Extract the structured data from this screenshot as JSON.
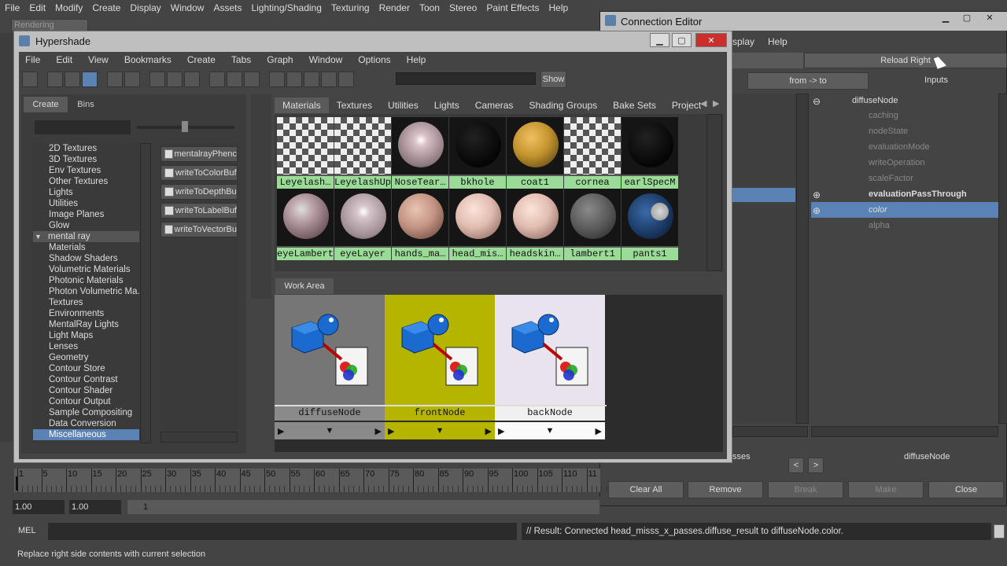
{
  "main_menu": [
    "File",
    "Edit",
    "Modify",
    "Create",
    "Display",
    "Window",
    "Assets",
    "Lighting/Shading",
    "Texturing",
    "Render",
    "Toon",
    "Stereo",
    "Paint Effects",
    "Help"
  ],
  "renderer_select": "Rendering",
  "connection_editor": {
    "title": "Connection Editor",
    "menu_partial": [
      "splay",
      "Help"
    ],
    "reload_right": "Reload Right",
    "from_to": "from -> to",
    "inputs": "Inputs",
    "right_node": "diffuseNode",
    "attributes": [
      "caching",
      "nodeState",
      "evaluationMode",
      "writeOperation",
      "scaleFactor",
      "evaluationPassThrough",
      "color",
      "alpha"
    ],
    "left_label_partial": "sses",
    "bottom_node": "diffuseNode",
    "buttons": [
      "Clear All",
      "Remove",
      "Break",
      "Make",
      "Close"
    ]
  },
  "hypershade": {
    "title": "Hypershade",
    "menu": [
      "File",
      "Edit",
      "View",
      "Bookmarks",
      "Create",
      "Tabs",
      "Graph",
      "Window",
      "Options",
      "Help"
    ],
    "show_button": "Show",
    "create_tabs": [
      "Create",
      "Bins"
    ],
    "create_list": [
      "2D Textures",
      "3D Textures",
      "Env Textures",
      "Other Textures",
      "Lights",
      "Utilities",
      "Image Planes",
      "Glow",
      "mental ray",
      "Materials",
      "Shadow Shaders",
      "Volumetric Materials",
      "Photonic Materials",
      "Photon Volumetric Ma...",
      "Textures",
      "Environments",
      "MentalRay Lights",
      "Light Maps",
      "Lenses",
      "Geometry",
      "Contour Store",
      "Contour Contrast",
      "Contour Shader",
      "Contour Output",
      "Sample Compositing",
      "Data Conversion",
      "Miscellaneous"
    ],
    "node_types": [
      "mentalrayPhenc",
      "writeToColorBuf",
      "writeToDepthBu",
      "writeToLabelBuf",
      "writeToVectorBu"
    ],
    "tabs": [
      "Materials",
      "Textures",
      "Utilities",
      "Lights",
      "Cameras",
      "Shading Groups",
      "Bake Sets",
      "Project"
    ],
    "swatches_row1": [
      "Leyelash…",
      "LeyelashUp",
      "NoseTear…",
      "bkhole",
      "coat1",
      "cornea",
      "earlSpecM"
    ],
    "swatches_row2": [
      "eyeLambert",
      "eyeLayer",
      "hands_ma…",
      "head_mis…",
      "headskin…",
      "lambert1",
      "pants1"
    ],
    "work_area_tab": "Work Area",
    "nodes": [
      {
        "name": "diffuseNode",
        "color": "#767676"
      },
      {
        "name": "frontNode",
        "color": "#b5b500"
      },
      {
        "name": "backNode",
        "color": "#e8e3ec"
      }
    ]
  },
  "timeline": {
    "ticks": [
      "1",
      "5",
      "10",
      "15",
      "20",
      "25",
      "30",
      "35",
      "40",
      "45",
      "50",
      "55",
      "60",
      "65",
      "70",
      "75",
      "80",
      "85",
      "90",
      "95",
      "100",
      "105",
      "110",
      "11"
    ],
    "start": "1.00",
    "end": "1.00",
    "current": "1"
  },
  "command_line": {
    "label": "MEL",
    "result": "// Result: Connected head_misss_x_passes.diffuse_result to diffuseNode.color."
  },
  "help_line": "Replace right side contents with current selection",
  "colors": {
    "accent": "#5a82b4",
    "swatch_label": "#9adb98"
  }
}
